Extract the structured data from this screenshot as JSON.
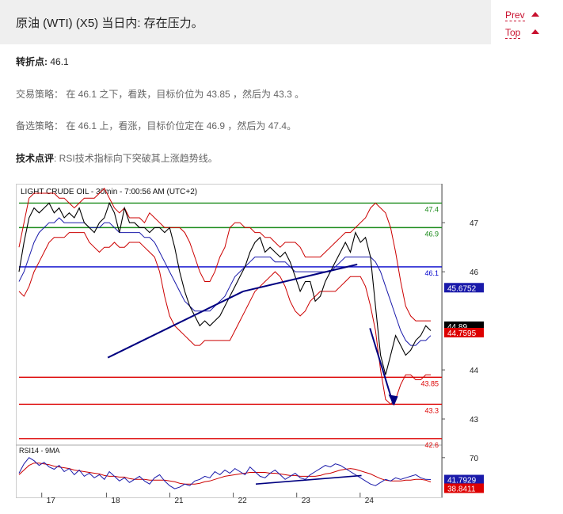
{
  "header": {
    "title": "原油 (WTI) (X5) 当日内: 存在压力。",
    "prev_label": "Prev",
    "top_label": "Top"
  },
  "analysis": {
    "pivot_label": "转折点:",
    "pivot_value": "46.1",
    "strategy": "交易策略： 在 46.1 之下，看跌，目标价位为 43.85 ，然后为 43.3 。",
    "alternative": "备选策略： 在 46.1 上，看涨，目标价位定在 46.9 ，然后为 47.4。",
    "comment_label": "技术点评",
    "comment_text": ": RSI技术指标向下突破其上涨趋势线。"
  },
  "colors": {
    "accent": "#c8102e",
    "price": "#000000",
    "bollinger": "#cc0000",
    "moving_average": "#1a1aaa",
    "resistance": "#1a8a1a",
    "pivot_line": "#0000cc",
    "support": "#dd0000",
    "trendline": "#000080",
    "current_price_box": "#000000",
    "red_box": "#dd0000",
    "blue_box": "#1a1aaa"
  },
  "chart_data": {
    "type": "line",
    "title": "LIGHT CRUDE OIL - 30min - 7:00:56 AM (UTC+2)",
    "x_labels": [
      "17",
      "18",
      "21",
      "22",
      "23",
      "24"
    ],
    "y_ticks": [
      47,
      46,
      44,
      43
    ],
    "ylim": [
      42.5,
      47.6
    ],
    "levels": [
      {
        "label": "47.4",
        "value": 47.4,
        "kind": "resistance"
      },
      {
        "label": "46.9",
        "value": 46.9,
        "kind": "resistance"
      },
      {
        "label": "46.1",
        "value": 46.1,
        "kind": "pivot"
      },
      {
        "label": "43.85",
        "value": 43.85,
        "kind": "support"
      },
      {
        "label": "43.3",
        "value": 43.3,
        "kind": "support"
      },
      {
        "label": "42.6",
        "value": 42.6,
        "kind": "support"
      }
    ],
    "markers": [
      {
        "label": "45.6752",
        "value": 45.6752,
        "style": "blue"
      },
      {
        "label": "44.89",
        "value": 44.89,
        "style": "black"
      },
      {
        "label": "44.7595",
        "value": 44.7595,
        "style": "red"
      }
    ],
    "price": [
      46.0,
      46.6,
      47.1,
      47.3,
      47.2,
      47.3,
      47.4,
      47.2,
      47.3,
      47.1,
      47.2,
      47.1,
      47.3,
      47.0,
      46.9,
      46.8,
      47.0,
      47.1,
      47.4,
      47.2,
      46.8,
      47.3,
      47.0,
      47.0,
      46.9,
      46.9,
      46.8,
      46.9,
      46.9,
      46.8,
      46.9,
      46.5,
      46.0,
      45.6,
      45.3,
      45.1,
      44.9,
      45.0,
      44.9,
      45.0,
      45.1,
      45.3,
      45.5,
      45.7,
      45.9,
      46.1,
      46.4,
      46.6,
      46.7,
      46.4,
      46.5,
      46.4,
      46.3,
      46.4,
      46.2,
      45.9,
      45.6,
      45.8,
      45.8,
      45.4,
      45.5,
      45.8,
      46.0,
      46.2,
      46.4,
      46.6,
      46.4,
      46.8,
      46.6,
      46.7,
      46.3,
      45.3,
      44.3,
      43.9,
      44.3,
      44.7,
      44.5,
      44.3,
      44.4,
      44.6,
      44.7,
      44.9,
      44.8
    ],
    "bb_upper": [
      46.5,
      47.0,
      47.5,
      47.6,
      47.6,
      47.6,
      47.6,
      47.6,
      47.5,
      47.5,
      47.4,
      47.3,
      47.4,
      47.5,
      47.5,
      47.5,
      47.6,
      47.7,
      47.5,
      47.3,
      47.2,
      47.3,
      47.1,
      47.1,
      47.1,
      47.0,
      47.2,
      47.1,
      47.0,
      46.9,
      46.9,
      46.9,
      46.9,
      46.8,
      46.6,
      46.3,
      46.0,
      45.8,
      45.8,
      46.0,
      46.3,
      46.5,
      46.9,
      47.0,
      47.0,
      46.9,
      46.9,
      46.8,
      46.8,
      46.7,
      46.7,
      46.6,
      46.5,
      46.6,
      46.6,
      46.6,
      46.5,
      46.3,
      46.3,
      46.3,
      46.3,
      46.4,
      46.5,
      46.6,
      46.7,
      46.8,
      46.8,
      46.9,
      47.0,
      47.1,
      47.3,
      47.4,
      47.3,
      47.2,
      46.9,
      46.4,
      45.8,
      45.3,
      45.1,
      45.0,
      45.0,
      45.0,
      45.0
    ],
    "bb_lower": [
      45.6,
      45.5,
      45.7,
      46.0,
      46.2,
      46.4,
      46.6,
      46.7,
      46.7,
      46.7,
      46.8,
      46.8,
      46.8,
      46.8,
      46.6,
      46.5,
      46.4,
      46.5,
      46.5,
      46.6,
      46.5,
      46.5,
      46.6,
      46.6,
      46.6,
      46.5,
      46.4,
      46.3,
      46.0,
      45.5,
      45.1,
      44.9,
      44.8,
      44.7,
      44.6,
      44.5,
      44.5,
      44.6,
      44.6,
      44.6,
      44.6,
      44.6,
      44.6,
      44.8,
      45.0,
      45.2,
      45.4,
      45.6,
      45.7,
      45.8,
      45.9,
      46.0,
      45.9,
      45.7,
      45.4,
      45.2,
      45.1,
      45.2,
      45.4,
      45.5,
      45.6,
      45.6,
      45.6,
      45.6,
      45.7,
      45.8,
      45.9,
      45.9,
      45.9,
      45.7,
      45.3,
      44.8,
      44.0,
      43.4,
      43.3,
      43.4,
      43.7,
      43.9,
      43.9,
      43.8,
      43.8,
      43.9,
      43.9
    ],
    "ma": [
      45.8,
      46.0,
      46.3,
      46.6,
      46.8,
      46.9,
      47.0,
      47.0,
      47.1,
      47.0,
      47.0,
      47.0,
      47.0,
      47.0,
      46.9,
      46.9,
      46.9,
      47.0,
      47.0,
      46.9,
      46.8,
      46.8,
      46.8,
      46.8,
      46.8,
      46.7,
      46.7,
      46.6,
      46.4,
      46.2,
      46.0,
      45.8,
      45.6,
      45.4,
      45.3,
      45.2,
      45.2,
      45.2,
      45.2,
      45.3,
      45.4,
      45.5,
      45.7,
      45.9,
      46.0,
      46.1,
      46.2,
      46.3,
      46.3,
      46.3,
      46.3,
      46.2,
      46.2,
      46.2,
      46.1,
      46.0,
      46.0,
      46.0,
      46.0,
      46.0,
      46.0,
      46.0,
      46.0,
      46.1,
      46.2,
      46.3,
      46.3,
      46.3,
      46.3,
      46.3,
      46.3,
      46.2,
      46.0,
      45.7,
      45.4,
      45.1,
      44.8,
      44.6,
      44.5,
      44.5,
      44.6,
      44.6,
      44.7
    ],
    "trendlines": [
      {
        "name": "support-trendline",
        "x": [
          0.21,
          0.53
        ],
        "y": [
          44.25,
          45.6
        ]
      },
      {
        "name": "rising-channel",
        "x": [
          0.53,
          0.8
        ],
        "y": [
          45.6,
          46.15
        ]
      },
      {
        "name": "projection-arrow",
        "x": [
          0.83,
          0.885
        ],
        "y": [
          44.85,
          43.3
        ]
      }
    ],
    "rsi": {
      "title": "RSI14 - 9MA",
      "y_ticks": [
        70
      ],
      "ylim": [
        25,
        80
      ],
      "value_label": "41.7929",
      "ma_label": "38.8411",
      "rsi_values": [
        50,
        62,
        70,
        66,
        60,
        64,
        58,
        55,
        60,
        52,
        56,
        48,
        54,
        46,
        50,
        44,
        48,
        42,
        52,
        46,
        40,
        44,
        38,
        42,
        46,
        40,
        36,
        44,
        48,
        40,
        34,
        30,
        32,
        36,
        34,
        40,
        42,
        46,
        44,
        52,
        48,
        54,
        50,
        56,
        52,
        48,
        58,
        52,
        46,
        44,
        50,
        54,
        48,
        42,
        46,
        50,
        44,
        42,
        48,
        52,
        56,
        60,
        58,
        62,
        60,
        56,
        52,
        48,
        44,
        40,
        36,
        34,
        38,
        42,
        40,
        44,
        42,
        44,
        46,
        48,
        44,
        42,
        41.8
      ],
      "ma_values": [
        48,
        54,
        60,
        63,
        63,
        62,
        61,
        59,
        58,
        57,
        56,
        54,
        53,
        52,
        51,
        50,
        49,
        47,
        46,
        46,
        45,
        45,
        43,
        42,
        42,
        42,
        41,
        41,
        41,
        41,
        40,
        39,
        37,
        36,
        36,
        36,
        37,
        39,
        40,
        42,
        44,
        46,
        47,
        48,
        49,
        50,
        51,
        51,
        51,
        51,
        50,
        50,
        49,
        48,
        47,
        47,
        46,
        46,
        46,
        46,
        47,
        49,
        50,
        52,
        54,
        55,
        56,
        55,
        53,
        51,
        49,
        46,
        43,
        41,
        40,
        40,
        40,
        41,
        41,
        42,
        42,
        41,
        38.8
      ],
      "trendlines": [
        {
          "name": "rsi-rising-trendline",
          "x": [
            0.56,
            0.81
          ],
          "y": [
            36,
            47
          ]
        }
      ]
    }
  }
}
